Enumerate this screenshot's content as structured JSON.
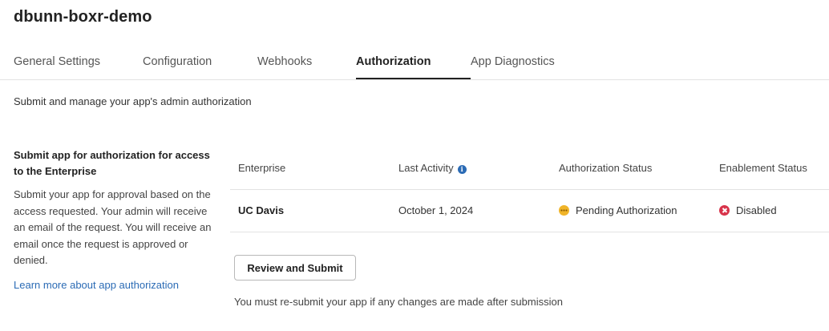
{
  "app": {
    "title": "dbunn-boxr-demo"
  },
  "tabs": [
    {
      "label": "General Settings"
    },
    {
      "label": "Configuration"
    },
    {
      "label": "Webhooks"
    },
    {
      "label": "Authorization",
      "active": true
    },
    {
      "label": "App Diagnostics"
    }
  ],
  "intro": "Submit and manage your app's admin authorization",
  "side_panel": {
    "heading": "Submit app for authorization for access to the Enterprise",
    "body": "Submit your app for approval based on the access requested. Your admin will receive an email of the request. You will receive an email once the request is approved or denied.",
    "link": "Learn more about app authorization"
  },
  "table": {
    "columns": [
      "Enterprise",
      "Last Activity",
      "Authorization Status",
      "Enablement Status"
    ],
    "rows": [
      {
        "enterprise": "UC Davis",
        "last_activity": "October 1, 2024",
        "authorization_status": "Pending Authorization",
        "enablement_status": "Disabled"
      }
    ]
  },
  "actions": {
    "review_submit": "Review and Submit"
  },
  "note": "You must re-submit your app if any changes are made after submission",
  "colors": {
    "link": "#2b6bb5",
    "pending": "#f0b429",
    "disabled": "#d8334a",
    "active_tab_underline": "#222222"
  },
  "icons": {
    "last_activity_info": "info-icon",
    "authorization_status": "pending-status-icon",
    "enablement_status": "disabled-status-icon"
  }
}
